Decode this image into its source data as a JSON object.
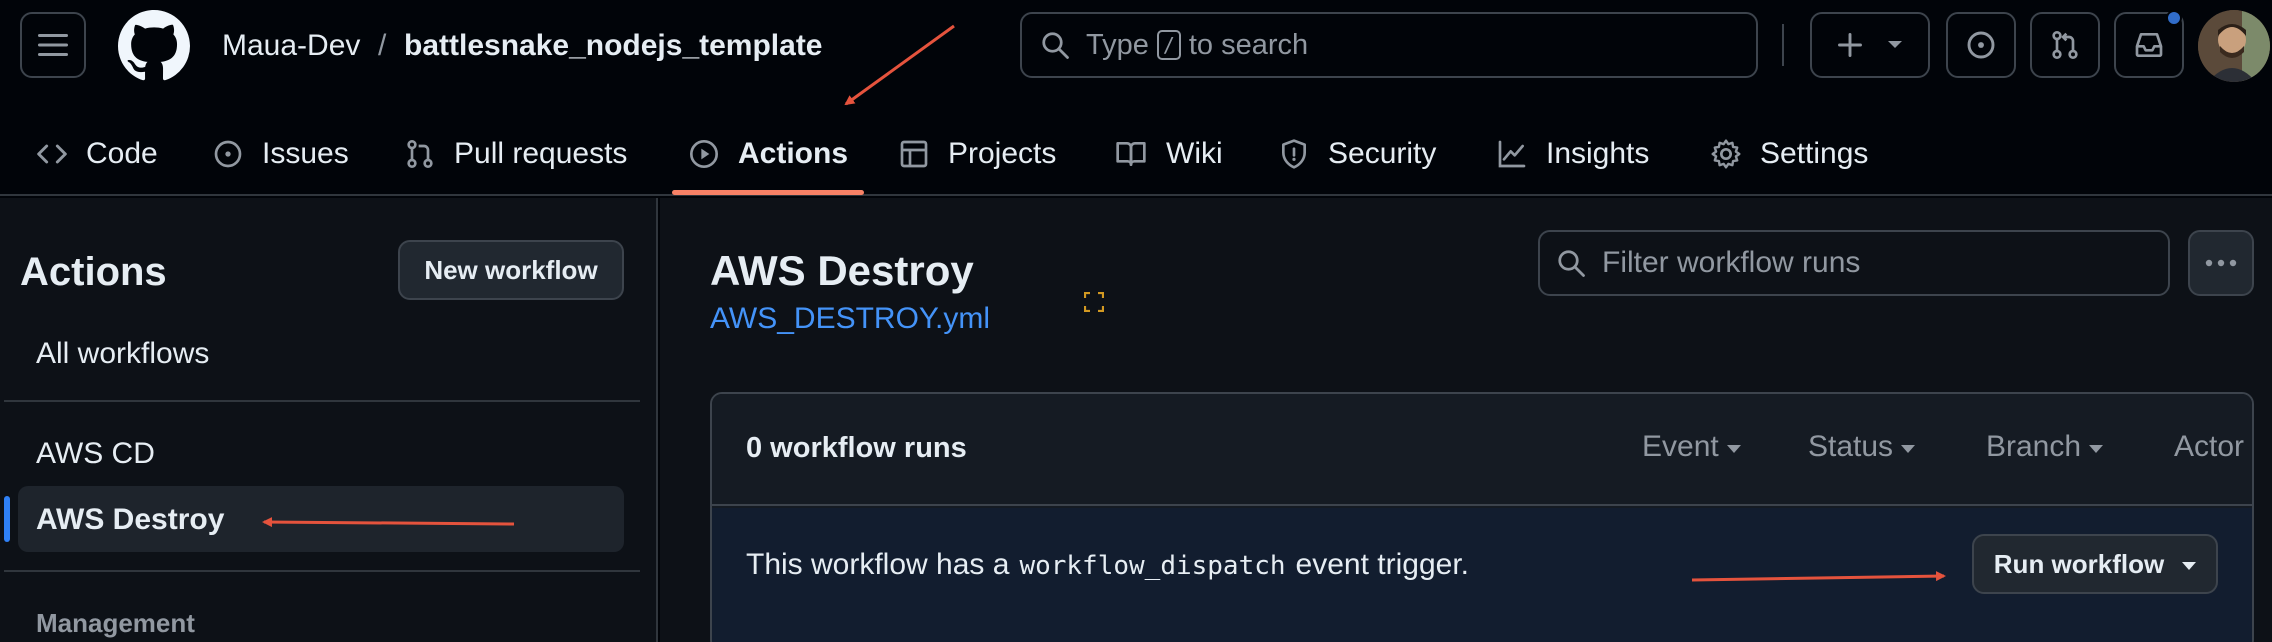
{
  "header": {
    "owner": "Maua-Dev",
    "separator": "/",
    "repo": "battlesnake_nodejs_template",
    "search_prefix": "Type",
    "search_key": "/",
    "search_suffix": "to search"
  },
  "tabs": [
    {
      "label": "Code",
      "icon": "code-icon"
    },
    {
      "label": "Issues",
      "icon": "issue-icon"
    },
    {
      "label": "Pull requests",
      "icon": "pull-request-icon"
    },
    {
      "label": "Actions",
      "icon": "play-icon",
      "active": true
    },
    {
      "label": "Projects",
      "icon": "table-icon"
    },
    {
      "label": "Wiki",
      "icon": "book-icon"
    },
    {
      "label": "Security",
      "icon": "shield-icon"
    },
    {
      "label": "Insights",
      "icon": "graph-icon"
    },
    {
      "label": "Settings",
      "icon": "gear-icon"
    }
  ],
  "sidebar": {
    "title": "Actions",
    "new_workflow_label": "New workflow",
    "all_workflows": "All workflows",
    "workflows": [
      {
        "label": "AWS CD",
        "active": false
      },
      {
        "label": "AWS Destroy",
        "active": true
      }
    ],
    "section": "Management"
  },
  "main": {
    "title": "AWS Destroy",
    "file": "AWS_DESTROY.yml",
    "filter_placeholder": "Filter workflow runs",
    "runs_count": "0 workflow runs",
    "filters": [
      "Event",
      "Status",
      "Branch",
      "Actor"
    ],
    "dispatch_prefix": "This workflow has a",
    "dispatch_code": "workflow_dispatch",
    "dispatch_suffix": "event trigger.",
    "run_workflow_label": "Run workflow"
  },
  "colors": {
    "background": "#010409",
    "panel": "#0d1117",
    "link": "#4493f8",
    "tab_underline": "#f78166",
    "annotation_arrow": "#e5533d",
    "active_marker": "#2f81f7"
  }
}
